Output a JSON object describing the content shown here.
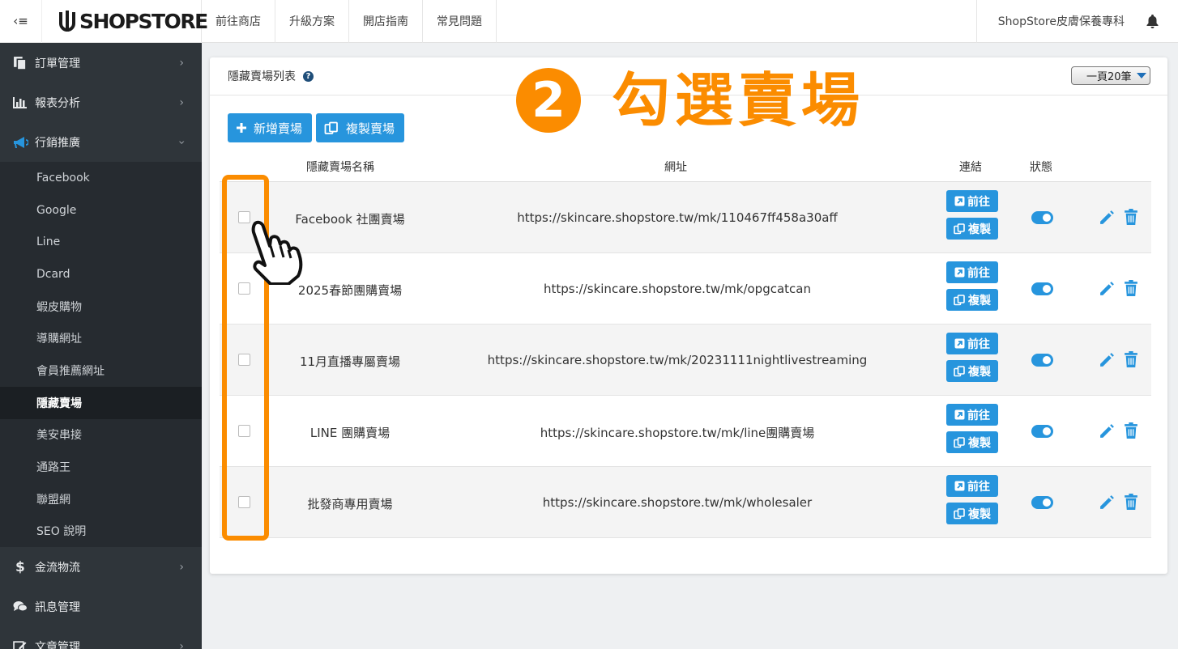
{
  "header": {
    "logo_text": "SHOPSTORE",
    "nav": [
      "前往商店",
      "升級方案",
      "開店指南",
      "常見問題"
    ],
    "store_name": "ShopStore皮膚保養專科"
  },
  "sidebar": {
    "items": [
      {
        "label": "訂單管理",
        "icon": "clipboard-icon"
      },
      {
        "label": "報表分析",
        "icon": "bar-chart-icon"
      },
      {
        "label": "行銷推廣",
        "icon": "megaphone-icon"
      }
    ],
    "submenu": [
      "Facebook",
      "Google",
      "Line",
      "Dcard",
      "蝦皮購物",
      "導購網址",
      "會員推薦網址",
      "隱藏賣場",
      "美安串接",
      "通路王",
      "聯盟網",
      "SEO 說明"
    ],
    "active_sub": "隱藏賣場",
    "items_after": [
      {
        "label": "金流物流",
        "icon": "dollar-icon"
      },
      {
        "label": "訊息管理",
        "icon": "chat-icon"
      },
      {
        "label": "文章管理",
        "icon": "edit-icon"
      }
    ]
  },
  "card": {
    "title": "隱藏賣場列表",
    "per_page": "一頁20筆",
    "add_button": "新增賣場",
    "copy_button": "複製賣場"
  },
  "table": {
    "headers": {
      "name": "隱藏賣場名稱",
      "url": "網址",
      "link": "連結",
      "status": "狀態"
    },
    "go_label": "前往",
    "copy_label": "複製",
    "rows": [
      {
        "name": "Facebook 社團賣場",
        "url": "https://skincare.shopstore.tw/mk/110467ff458a30aff",
        "enabled": true
      },
      {
        "name": "2025春節團購賣場",
        "url": "https://skincare.shopstore.tw/mk/opgcatcan",
        "enabled": true
      },
      {
        "name": "11月直播專屬賣場",
        "url": "https://skincare.shopstore.tw/mk/20231111nightlivestreaming",
        "enabled": true
      },
      {
        "name": "LINE 團購賣場",
        "url": "https://skincare.shopstore.tw/mk/line團購賣場",
        "enabled": true
      },
      {
        "name": "批發商專用賣場",
        "url": "https://skincare.shopstore.tw/mk/wholesaler",
        "enabled": true
      }
    ]
  },
  "annotation": {
    "step_number": "2",
    "text": "勾選賣場",
    "color": "#fb8c00"
  },
  "colors": {
    "accent": "#2795dd",
    "sidebar_bg": "#2f353a"
  }
}
